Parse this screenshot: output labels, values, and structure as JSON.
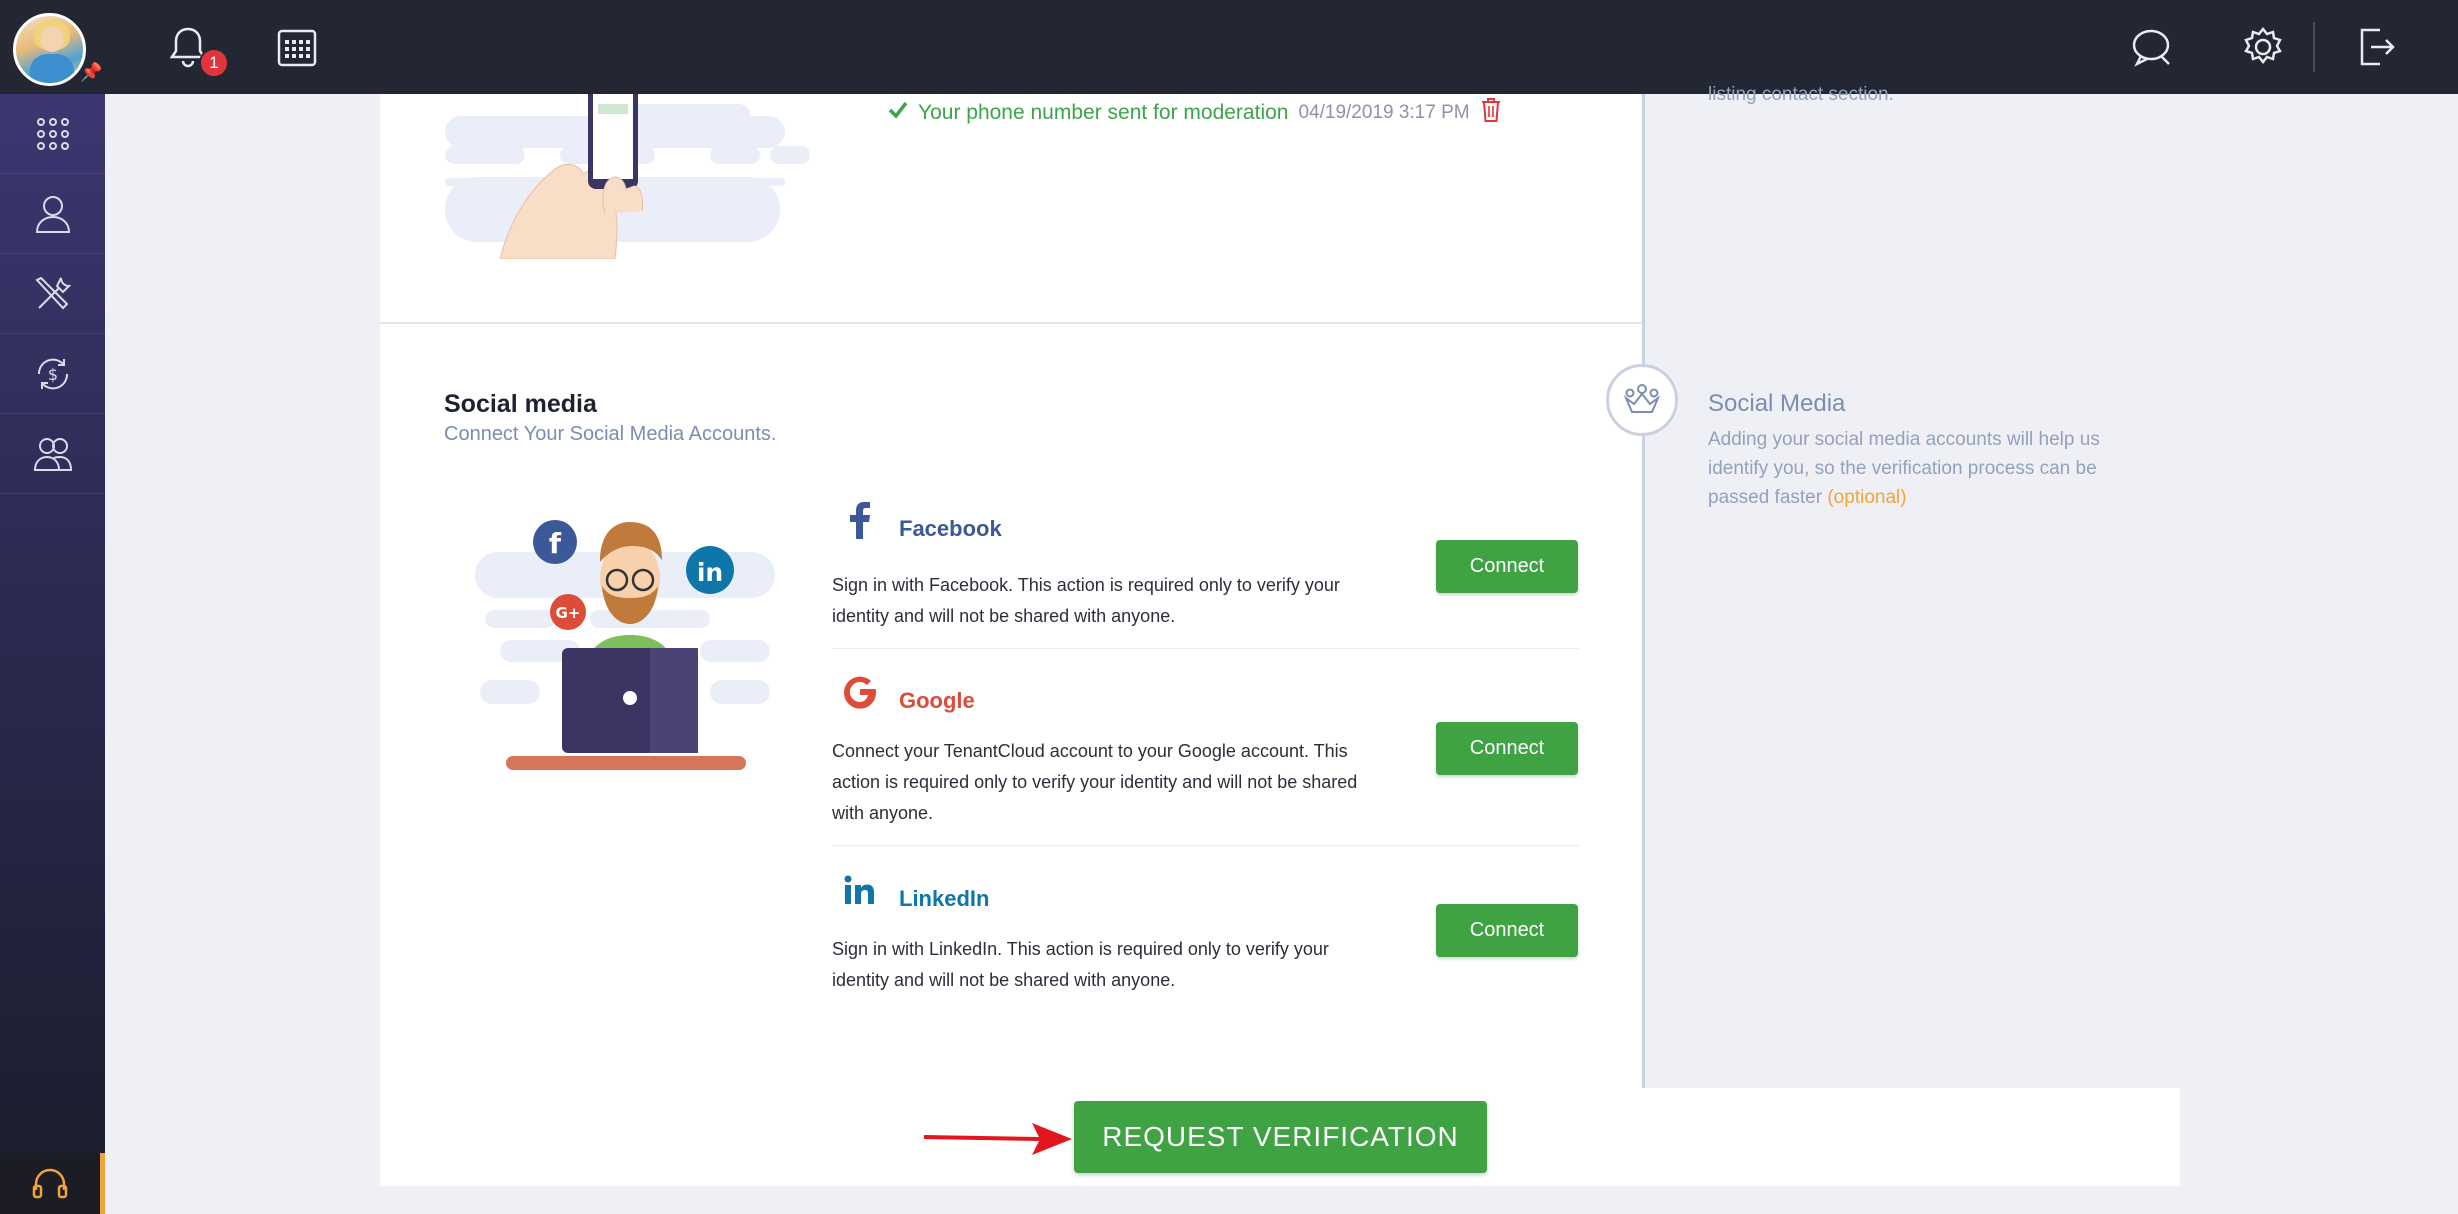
{
  "topbar": {
    "notification_count": "1",
    "icons": [
      "bell-icon",
      "calendar-icon",
      "chat-icon",
      "gear-icon",
      "logout-icon"
    ]
  },
  "sidebar": {
    "items": [
      "apps-grid-icon",
      "user-icon",
      "tools-icon",
      "money-cycle-icon",
      "users-group-icon"
    ],
    "support_icon": "headset-icon"
  },
  "phone_section": {
    "partial_text": "listing contact section.",
    "moderation_status": "Your phone number sent for moderation",
    "moderation_date": "04/19/2019 3:17 PM"
  },
  "social": {
    "title": "Social media",
    "subtitle": "Connect Your Social Media Accounts.",
    "accounts": [
      {
        "name": "Facebook",
        "description": "Sign in with Facebook. This action is required only to verify your identity and will not be shared with anyone.",
        "button": "Connect",
        "color": "#3b5998"
      },
      {
        "name": "Google",
        "description": "Connect your TenantCloud account to your Google account. This action is required only to verify your identity and will not be shared with anyone.",
        "button": "Connect",
        "color": "#dd4b39"
      },
      {
        "name": "LinkedIn",
        "description": "Sign in with LinkedIn. This action is required only to verify your identity and will not be shared with anyone.",
        "button": "Connect",
        "color": "#0e76a8"
      }
    ]
  },
  "side_info": {
    "title": "Social Media",
    "description": "Adding your social media accounts will help us identify you, so the verification process can be passed faster",
    "optional": "(optional)"
  },
  "footer": {
    "request_button": "REQUEST VERIFICATION"
  },
  "colors": {
    "accent_green": "#3fa243",
    "sidebar": "#2e2b55",
    "topbar": "#232733",
    "optional_orange": "#f1a33a"
  }
}
